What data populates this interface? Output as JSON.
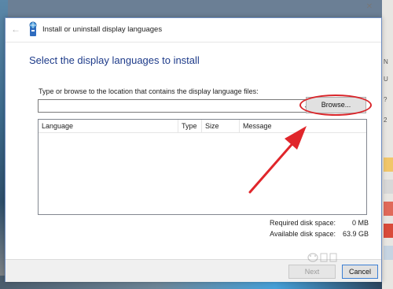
{
  "window": {
    "title": "Install or uninstall display languages",
    "back_icon": "back-arrow-icon",
    "app_icon": "language-globe-icon"
  },
  "main": {
    "heading": "Select the display languages to install",
    "path_label": "Type or browse to the location that contains the display language files:",
    "path_value": "",
    "browse_label": "Browse...",
    "columns": [
      "Language",
      "Type",
      "Size",
      "Message"
    ]
  },
  "disk": {
    "required_label": "Required disk space:",
    "required_value": "0 MB",
    "available_label": "Available disk space:",
    "available_value": "63.9 GB"
  },
  "footer": {
    "next_label": "Next",
    "cancel_label": "Cancel"
  },
  "annotation": {
    "oval_color": "#d9262b",
    "arrow_color": "#e0262b"
  },
  "colors": {
    "heading": "#1e3b8a",
    "focus_border": "#3c7fd4"
  }
}
